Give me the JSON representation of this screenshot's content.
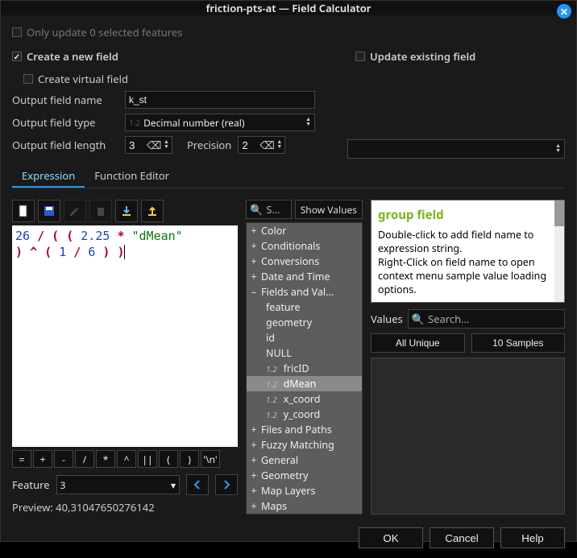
{
  "window_title": "friction-pts-at — Field Calculator",
  "only_update": {
    "label": "Only update 0 selected features",
    "checked": false,
    "enabled": false
  },
  "create_new_field": {
    "label": "Create a new field",
    "checked": true
  },
  "update_existing_field": {
    "label": "Update existing field",
    "checked": false
  },
  "create_virtual": {
    "label": "Create virtual field",
    "checked": false
  },
  "output_name": {
    "label": "Output field name",
    "value": "k_st"
  },
  "output_type": {
    "label": "Output field type",
    "value": "Decimal number (real)"
  },
  "output_length": {
    "label": "Output field length",
    "value": "3"
  },
  "precision": {
    "label": "Precision",
    "value": "2"
  },
  "tabs": {
    "expression": "Expression",
    "function_editor": "Function Editor"
  },
  "expression_tokens": [
    {
      "t": "num",
      "v": "26"
    },
    {
      "t": "sp"
    },
    {
      "t": "op",
      "v": "/"
    },
    {
      "t": "sp"
    },
    {
      "t": "par",
      "v": "("
    },
    {
      "t": "sp"
    },
    {
      "t": "par",
      "v": "("
    },
    {
      "t": "sp"
    },
    {
      "t": "num",
      "v": "2.25"
    },
    {
      "t": "sp"
    },
    {
      "t": "op",
      "v": "*"
    },
    {
      "t": "sp"
    },
    {
      "t": "fld",
      "v": "\"dMean\""
    },
    {
      "t": "br"
    },
    {
      "t": "par",
      "v": ")"
    },
    {
      "t": "sp"
    },
    {
      "t": "op",
      "v": "^"
    },
    {
      "t": "sp"
    },
    {
      "t": "par",
      "v": "("
    },
    {
      "t": "sp"
    },
    {
      "t": "num",
      "v": "1"
    },
    {
      "t": "sp"
    },
    {
      "t": "op",
      "v": "/"
    },
    {
      "t": "sp"
    },
    {
      "t": "num",
      "v": "6"
    },
    {
      "t": "sp"
    },
    {
      "t": "par",
      "v": ")"
    },
    {
      "t": "sp"
    },
    {
      "t": "par",
      "v": ")"
    },
    {
      "t": "cursor"
    }
  ],
  "operators": [
    "=",
    "+",
    "-",
    "/",
    "*",
    "^",
    "||",
    "(",
    ")",
    "'\\n'"
  ],
  "feature": {
    "label": "Feature",
    "value": "3"
  },
  "preview": {
    "label": "Preview:",
    "value": "40,31047650276142"
  },
  "search_placeholder": "S…",
  "show_values_label": "Show Values",
  "tree": {
    "groups_before": [
      "Color",
      "Conditionals",
      "Conversions",
      "Date and Time"
    ],
    "expanded": {
      "label": "Fields and Val…",
      "items": [
        "feature",
        "geometry",
        "id",
        "NULL"
      ],
      "attrs": [
        "fricID",
        "dMean",
        "x_coord",
        "y_coord"
      ],
      "selected": "dMean"
    },
    "groups_after": [
      "Files and Paths",
      "Fuzzy Matching",
      "General",
      "Geometry",
      "Map Layers",
      "Maps"
    ]
  },
  "help": {
    "title": "group field",
    "body1": "Double-click to add field name to expression string.",
    "body2": "Right-Click on field name to open context menu sample value loading options."
  },
  "values": {
    "label": "Values",
    "search_placeholder": "Search…",
    "all_unique": "All Unique",
    "samples": "10 Samples"
  },
  "buttons": {
    "ok": "OK",
    "cancel": "Cancel",
    "help": "Help"
  }
}
